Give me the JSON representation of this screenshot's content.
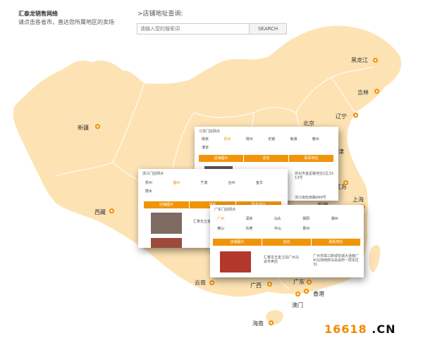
{
  "header": {
    "title": "汇泰龙销售网络",
    "subtitle": "请点击各省市，直达您所属地区的卖场"
  },
  "search": {
    "label": ">店铺地址查询:",
    "placeholder": "请输入您的搜索词",
    "button": "SEARCH"
  },
  "provinces": [
    "黑龙江",
    "吉林",
    "辽宁",
    "北京",
    "新疆",
    "西藏",
    "江苏",
    "上海",
    "安徽",
    "云南",
    "广西",
    "广东",
    "香港",
    "澳门",
    "海南",
    "津"
  ],
  "cards": {
    "jiangsu": {
      "title": "江苏门店网点",
      "cities": [
        "南京",
        "苏州",
        "常州",
        "无锡",
        "南通",
        "泰州",
        "淮安"
      ],
      "headers": [
        "店铺图片",
        "店名",
        "联系地址"
      ],
      "address": "苏州市金星路地址1区33-13号",
      "address2": "浙江南虹西路999号"
    },
    "zhejiang": {
      "title": "浙江门店网点",
      "cities": [
        "杭州",
        "温州",
        "宁波",
        "台州",
        "金华",
        "丽水"
      ],
      "headers": [
        "店铺图片",
        "店名",
        "联系地址"
      ],
      "shop": "汇泰龙五金"
    },
    "guangdong": {
      "title": "广东门店网点",
      "cities": [
        "广州",
        "深圳",
        "汕头",
        "揭阳",
        "潮州",
        "佛山",
        "东莞",
        "中山",
        "惠州"
      ],
      "headers": [
        "店铺图片",
        "店名",
        "联系地址"
      ],
      "shop": "汇泰龙五金卫浴广州马会专卖店",
      "address": "广州市珠江新城花城大道旁广州马场南侧马会会所一层东区31"
    }
  },
  "brand": {
    "main": "16618",
    "suffix": " .CN"
  },
  "colors": {
    "map": "#fde3b4",
    "accent": "#f0950a"
  }
}
